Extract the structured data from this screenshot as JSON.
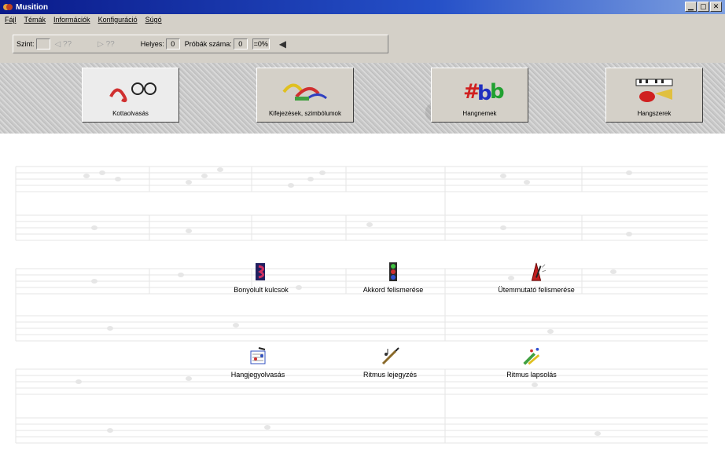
{
  "window": {
    "title": "Musition"
  },
  "menu": [
    "Fájl",
    "Témák",
    "Információk",
    "Konfiguráció",
    "Súgó"
  ],
  "toolbar": {
    "level_label": "Szint:",
    "level_value": "",
    "correct_label": "Helyes:",
    "correct_value": "0",
    "attempts_label": "Próbák száma:",
    "attempts_value": "0",
    "percent": "=0%",
    "nav_back": "◁ ??",
    "nav_forward": "▷ ??"
  },
  "main_buttons": [
    {
      "label": "Kottaolvasás"
    },
    {
      "label": "Kifejezések, szimbólumok"
    },
    {
      "label": "Hangnemek"
    },
    {
      "label": "Hangszerek"
    }
  ],
  "sub_items": [
    {
      "label": "Bonyolult kulcsok"
    },
    {
      "label": "Akkord felismerése"
    },
    {
      "label": "Ütemmutató felismerése"
    },
    {
      "label": "Hangjegyolvasás"
    },
    {
      "label": "Ritmus lejegyzés"
    },
    {
      "label": "Ritmus lapsolás"
    }
  ],
  "icons": {
    "app": "music-app-icon",
    "minimize": "minimize-icon",
    "maximize": "maximize-icon",
    "close": "close-icon",
    "speaker": "speaker-icon"
  },
  "colors": {
    "title_start": "#0a1a8a",
    "title_end": "#7ea0e0",
    "chrome": "#d4d0c8"
  }
}
